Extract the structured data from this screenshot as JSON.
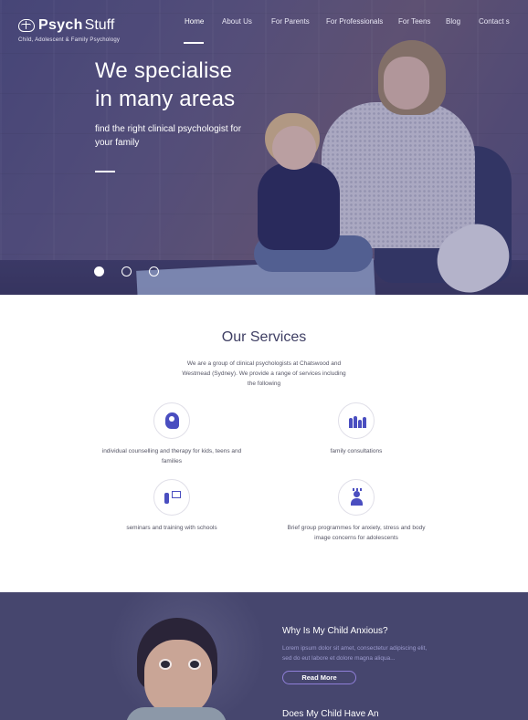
{
  "brand": {
    "name_bold": "Psych",
    "name_light": "Stuff",
    "tagline": "Child, Adolescent & Family Psychology"
  },
  "nav": {
    "items": [
      {
        "label": "Home",
        "active": true
      },
      {
        "label": "About Us",
        "active": false
      },
      {
        "label": "For Parents",
        "active": false
      },
      {
        "label": "For Professionals",
        "active": false
      },
      {
        "label": "For Teens",
        "active": false
      },
      {
        "label": "Blog",
        "active": false
      },
      {
        "label": "Contact s",
        "active": false
      }
    ]
  },
  "hero": {
    "title_line1": "We specialise",
    "title_line2": "in many areas",
    "subtitle": "find the right clinical psychologist for your family",
    "slides": 3,
    "active_slide": 1
  },
  "services": {
    "title": "Our Services",
    "description": "We are a group of clinical psychologists at Chatswood and Westmead (Sydney). We provide a range of services including the following",
    "items": [
      {
        "icon": "head-icon",
        "label": "individual counselling and therapy for kids, teens and families"
      },
      {
        "icon": "family-icon",
        "label": "family consultations"
      },
      {
        "icon": "teaching-icon",
        "label": "seminars and training with schools"
      },
      {
        "icon": "group-icon",
        "label": "Brief group programmes for anxiety, stress and body image concerns for adolescents"
      }
    ]
  },
  "feature": {
    "title": "Why Is My Child Anxious?",
    "text": "Lorem ipsum dolor sit amet, consectetur adipiscing elit, sed do eut labore et dolore magna aliqua...",
    "button_label": "Read More",
    "next_title": "Does My Child Have An"
  },
  "colors": {
    "hero_overlay": "#4a4a7a",
    "accent": "#4a4ec0",
    "section_dark": "#46466e",
    "button_border": "#8f7fd8"
  }
}
